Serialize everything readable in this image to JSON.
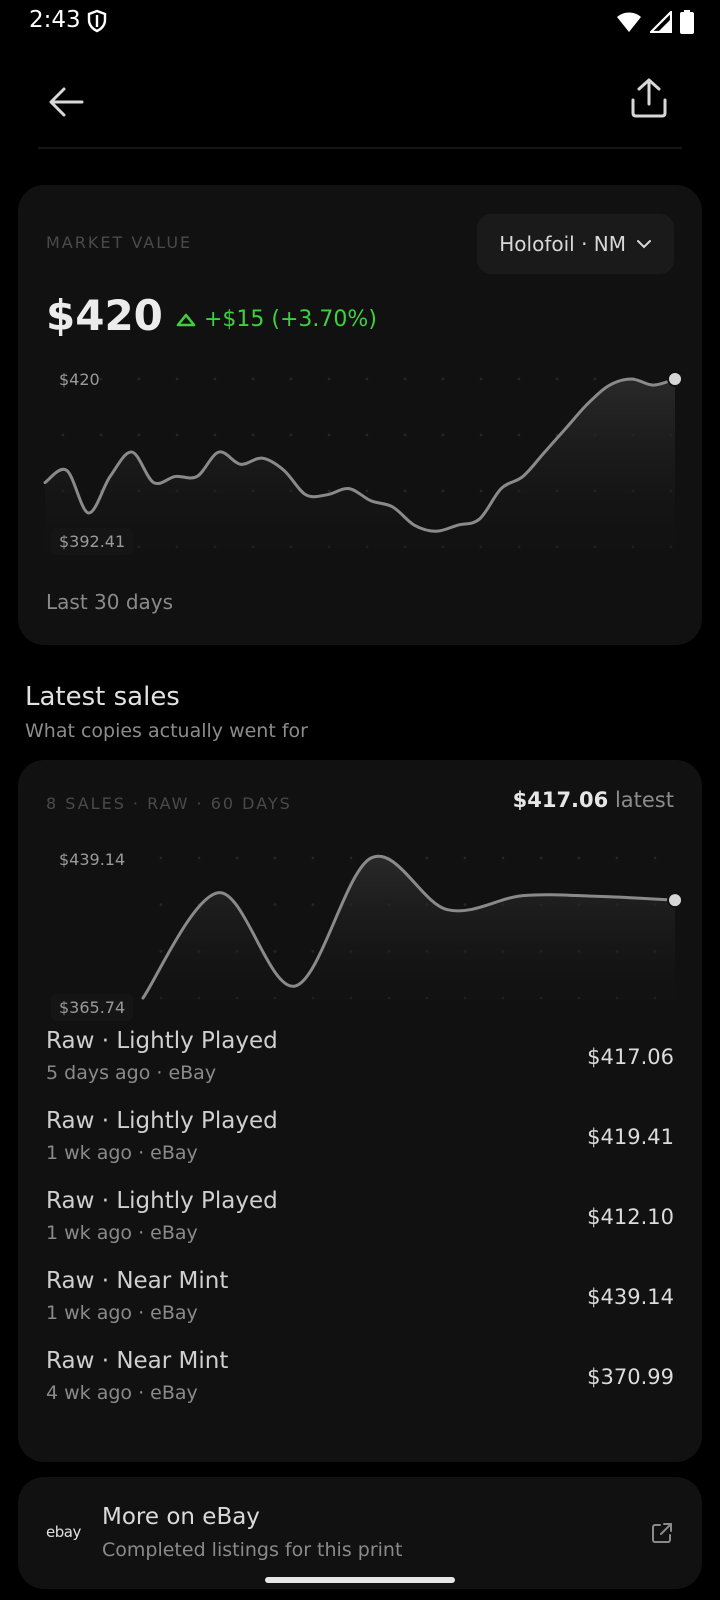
{
  "status": {
    "time": "2:43"
  },
  "market_value": {
    "label": "MARKET VALUE",
    "variant": "Holofoil · NM",
    "price": "$420",
    "change": "+$15 (+3.70%)",
    "chart_high": "$420",
    "chart_low": "$392.41",
    "period": "Last 30 days",
    "colors": {
      "change": "#3fcf3f"
    },
    "chart_data": {
      "type": "line",
      "x": [
        1,
        2,
        3,
        4,
        5,
        6,
        7,
        8,
        9,
        10,
        11,
        12,
        13,
        14,
        15,
        16,
        17,
        18,
        19,
        20,
        21,
        22,
        23,
        24,
        25,
        26,
        27,
        28,
        29,
        30
      ],
      "values": [
        403,
        405,
        398,
        404,
        408,
        403,
        404,
        404,
        408,
        406,
        407,
        405,
        401,
        401,
        402,
        400,
        399,
        396,
        395,
        396,
        397,
        402,
        404,
        408,
        412,
        416,
        419,
        420,
        419,
        420
      ],
      "ylim": [
        392.41,
        420
      ],
      "series_color": "#8a8a8a"
    }
  },
  "latest_sales": {
    "title": "Latest sales",
    "subtitle": "What copies actually went for",
    "meta": "8 SALES · RAW · 60 DAYS",
    "latest_price": "$417.06",
    "latest_word": "latest",
    "chart_high": "$439.14",
    "chart_low": "$365.74",
    "chart_data": {
      "type": "line",
      "x": [
        1,
        2,
        3,
        4,
        5,
        6,
        7,
        8
      ],
      "values": [
        365.74,
        421.0,
        372.0,
        439.14,
        412.1,
        419.41,
        419.0,
        417.06
      ],
      "ylim": [
        365.74,
        439.14
      ]
    },
    "items": [
      {
        "title": "Raw · Lightly Played",
        "sub": "5 days ago · eBay",
        "price": "$417.06"
      },
      {
        "title": "Raw · Lightly Played",
        "sub": "1 wk ago · eBay",
        "price": "$419.41"
      },
      {
        "title": "Raw · Lightly Played",
        "sub": "1 wk ago · eBay",
        "price": "$412.10"
      },
      {
        "title": "Raw · Near Mint",
        "sub": "1 wk ago · eBay",
        "price": "$439.14"
      },
      {
        "title": "Raw · Near Mint",
        "sub": "4 wk ago · eBay",
        "price": "$370.99"
      }
    ]
  },
  "ebay": {
    "logo": "ebay",
    "title": "More on eBay",
    "subtitle": "Completed listings for this print"
  }
}
